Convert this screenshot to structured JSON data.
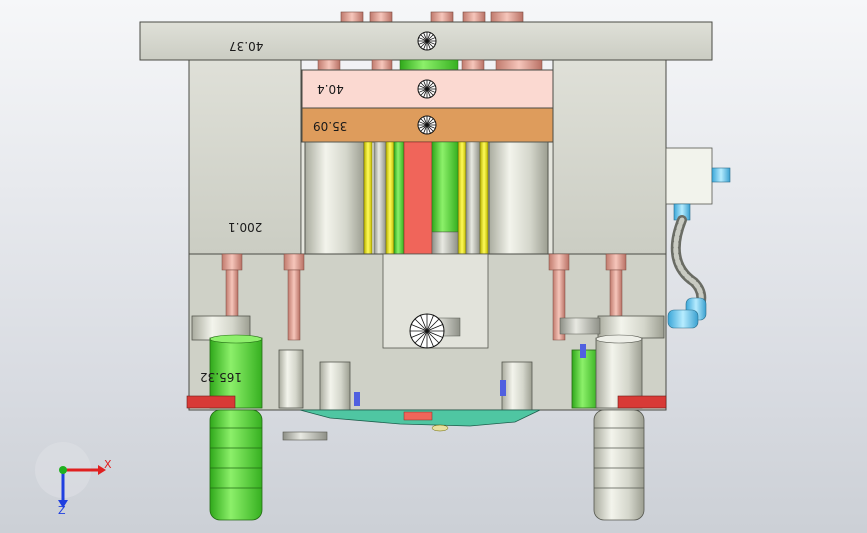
{
  "viewport": {
    "background_top": "#f6f7f9",
    "background_bottom": "#ccd0d6"
  },
  "dimensions": {
    "top_plate": "40.37",
    "a_plate": "40.4",
    "b_plate": "35.09",
    "side_block": "200.1",
    "lower_block": "165.32"
  },
  "triad": {
    "x_label": "X",
    "z_label": "Z",
    "x_color": "#e02020",
    "y_color": "#20b020",
    "z_color": "#2040e0"
  },
  "colors": {
    "plate_gray": "#d2d4cb",
    "plate_pink": "#fbd9d1",
    "plate_orange": "#de9c5c",
    "runner_red": "#f0655a",
    "guide_green": "#5fdc3c",
    "pin_copper": "#e3a79b",
    "rest_red": "#d83a36",
    "fitting_blue": "#6cc9ee"
  },
  "icons": {
    "center_marker": "center-mark-icon",
    "triad": "axis-triad-icon"
  }
}
